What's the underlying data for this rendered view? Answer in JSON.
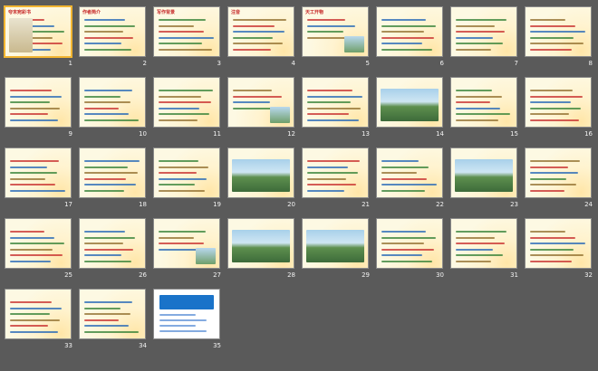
{
  "slides": [
    {
      "n": "1",
      "title": "夸末宛彩书",
      "theme": "cover"
    },
    {
      "n": "2",
      "title": "作者简介",
      "theme": "text"
    },
    {
      "n": "3",
      "title": "写作背景",
      "theme": "text"
    },
    {
      "n": "4",
      "title": "注音",
      "theme": "text"
    },
    {
      "n": "5",
      "title": "天工开物",
      "theme": "mixed"
    },
    {
      "n": "6",
      "title": "",
      "theme": "text"
    },
    {
      "n": "7",
      "title": "",
      "theme": "text"
    },
    {
      "n": "8",
      "title": "",
      "theme": "text"
    },
    {
      "n": "9",
      "title": "",
      "theme": "text"
    },
    {
      "n": "10",
      "title": "",
      "theme": "text"
    },
    {
      "n": "11",
      "title": "",
      "theme": "text"
    },
    {
      "n": "12",
      "title": "",
      "theme": "mixed"
    },
    {
      "n": "13",
      "title": "",
      "theme": "text"
    },
    {
      "n": "14",
      "title": "",
      "theme": "landscape"
    },
    {
      "n": "15",
      "title": "",
      "theme": "text"
    },
    {
      "n": "16",
      "title": "",
      "theme": "text"
    },
    {
      "n": "17",
      "title": "",
      "theme": "text"
    },
    {
      "n": "18",
      "title": "",
      "theme": "text"
    },
    {
      "n": "19",
      "title": "",
      "theme": "text"
    },
    {
      "n": "20",
      "title": "",
      "theme": "landscape"
    },
    {
      "n": "21",
      "title": "",
      "theme": "text"
    },
    {
      "n": "22",
      "title": "",
      "theme": "text"
    },
    {
      "n": "23",
      "title": "",
      "theme": "landscape"
    },
    {
      "n": "24",
      "title": "",
      "theme": "text"
    },
    {
      "n": "25",
      "title": "",
      "theme": "text"
    },
    {
      "n": "26",
      "title": "",
      "theme": "text"
    },
    {
      "n": "27",
      "title": "",
      "theme": "mixed"
    },
    {
      "n": "28",
      "title": "",
      "theme": "landscape"
    },
    {
      "n": "29",
      "title": "",
      "theme": "landscape"
    },
    {
      "n": "30",
      "title": "",
      "theme": "text"
    },
    {
      "n": "31",
      "title": "",
      "theme": "text"
    },
    {
      "n": "32",
      "title": "",
      "theme": "text"
    },
    {
      "n": "33",
      "title": "",
      "theme": "text"
    },
    {
      "n": "34",
      "title": "",
      "theme": "text"
    },
    {
      "n": "35",
      "title": "",
      "theme": "logo"
    }
  ],
  "colors": {
    "background": "#5a5a5a",
    "slide": "#fdf9e3",
    "accent_red": "#c62828",
    "accent_blue": "#1e63b5",
    "accent_green": "#2e7d32",
    "selection": "#f2b531",
    "logo_blue": "#1a73c9"
  }
}
